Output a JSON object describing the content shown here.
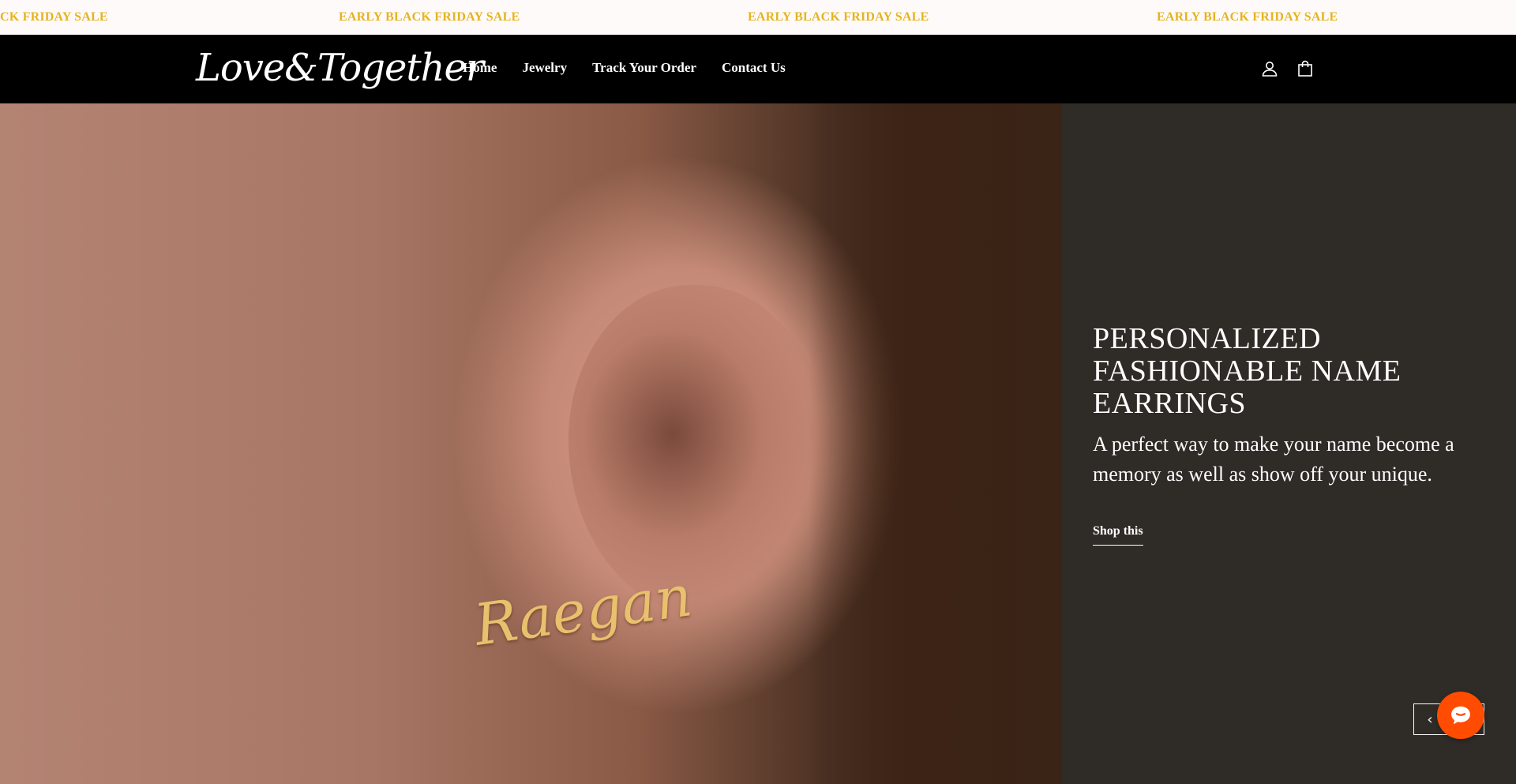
{
  "announcement": {
    "messages": [
      "EARLY BLACK FRIDAY SALE",
      "EARLY BLACK FRIDAY SALE",
      "EARLY BLACK FRIDAY SALE",
      "EARLY BLACK FRIDAY SALE"
    ],
    "first_partial": "CK FRIDAY SALE",
    "color": "#e5b41f"
  },
  "header": {
    "logo_text": "Love&Together",
    "nav": [
      "Home",
      "Jewelry",
      "Track Your Order",
      "Contact Us"
    ],
    "icons": [
      "account-icon",
      "cart-icon"
    ]
  },
  "hero": {
    "title": "PERSONALIZED FASHIONABLE NAME EARRINGS",
    "subtitle": "A perfect way to make your name become a memory as well as show off your unique.",
    "cta_label": "Shop this",
    "earring_text": "Raegan",
    "prev_label": "‹",
    "next_label": "›"
  },
  "chat": {
    "icon": "chat-icon",
    "color": "#ff4c00"
  }
}
